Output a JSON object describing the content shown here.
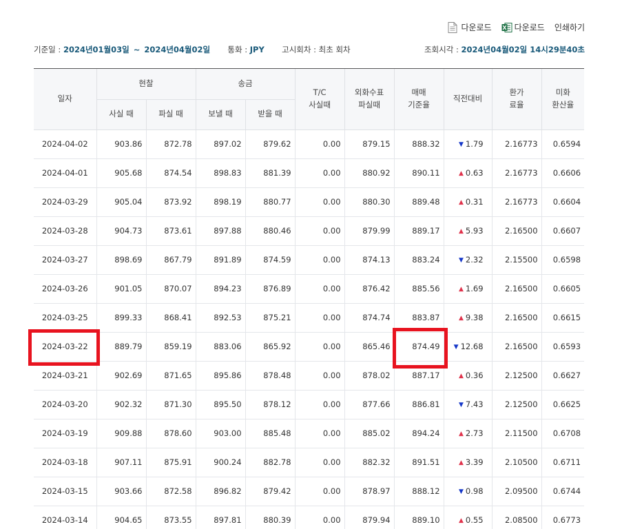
{
  "toolbar": {
    "pdf_download": "다운로드",
    "excel_download": "다운로드",
    "print": "인쇄하기"
  },
  "info": {
    "base_date_label": "기준일 :",
    "start_date": "2024년01월03일",
    "tilde": "~",
    "end_date": "2024년04월02일",
    "currency_label": "통화 :",
    "currency": "JPY",
    "notice_round_label": "고시회차 :",
    "notice_round": "최초 회차",
    "query_time_label": "조회시각 :",
    "query_time": "2024년04월02일 14시29분40초"
  },
  "headers": {
    "date": "일자",
    "cash": "현찰",
    "cash_buy": "사실 때",
    "cash_sell": "파실 때",
    "remit": "송금",
    "remit_send": "보낼 때",
    "remit_receive": "받을 때",
    "tc": "T/C\n사실때",
    "check": "외화수표\n파실때",
    "base_rate": "매매\n기준율",
    "change": "직전대비",
    "commission": "환가\n료율",
    "usd_rate": "미화\n환산율"
  },
  "colors": {
    "up_arrow": "#e0334c",
    "down_arrow": "#1537c8",
    "highlight": "#e8131f",
    "accent_text": "#1a5a7a"
  },
  "rows": [
    {
      "date": "2024-04-02",
      "cash_buy": "903.86",
      "cash_sell": "872.78",
      "send": "897.02",
      "receive": "879.62",
      "tc": "0.00",
      "check": "879.15",
      "base": "888.32",
      "dir": "down",
      "change": "1.79",
      "commission": "2.16773",
      "usd": "0.6594"
    },
    {
      "date": "2024-04-01",
      "cash_buy": "905.68",
      "cash_sell": "874.54",
      "send": "898.83",
      "receive": "881.39",
      "tc": "0.00",
      "check": "880.92",
      "base": "890.11",
      "dir": "up",
      "change": "0.63",
      "commission": "2.16773",
      "usd": "0.6606"
    },
    {
      "date": "2024-03-29",
      "cash_buy": "905.04",
      "cash_sell": "873.92",
      "send": "898.19",
      "receive": "880.77",
      "tc": "0.00",
      "check": "880.30",
      "base": "889.48",
      "dir": "up",
      "change": "0.31",
      "commission": "2.16773",
      "usd": "0.6604"
    },
    {
      "date": "2024-03-28",
      "cash_buy": "904.73",
      "cash_sell": "873.61",
      "send": "897.88",
      "receive": "880.46",
      "tc": "0.00",
      "check": "879.99",
      "base": "889.17",
      "dir": "up",
      "change": "5.93",
      "commission": "2.16500",
      "usd": "0.6607"
    },
    {
      "date": "2024-03-27",
      "cash_buy": "898.69",
      "cash_sell": "867.79",
      "send": "891.89",
      "receive": "874.59",
      "tc": "0.00",
      "check": "874.13",
      "base": "883.24",
      "dir": "down",
      "change": "2.32",
      "commission": "2.15500",
      "usd": "0.6598"
    },
    {
      "date": "2024-03-26",
      "cash_buy": "901.05",
      "cash_sell": "870.07",
      "send": "894.23",
      "receive": "876.89",
      "tc": "0.00",
      "check": "876.42",
      "base": "885.56",
      "dir": "up",
      "change": "1.69",
      "commission": "2.16500",
      "usd": "0.6605"
    },
    {
      "date": "2024-03-25",
      "cash_buy": "899.33",
      "cash_sell": "868.41",
      "send": "892.53",
      "receive": "875.21",
      "tc": "0.00",
      "check": "874.74",
      "base": "883.87",
      "dir": "up",
      "change": "9.38",
      "commission": "2.16500",
      "usd": "0.6615"
    },
    {
      "date": "2024-03-22",
      "cash_buy": "889.79",
      "cash_sell": "859.19",
      "send": "883.06",
      "receive": "865.92",
      "tc": "0.00",
      "check": "865.46",
      "base": "874.49",
      "dir": "down",
      "change": "12.68",
      "commission": "2.16500",
      "usd": "0.6593"
    },
    {
      "date": "2024-03-21",
      "cash_buy": "902.69",
      "cash_sell": "871.65",
      "send": "895.86",
      "receive": "878.48",
      "tc": "0.00",
      "check": "878.02",
      "base": "887.17",
      "dir": "up",
      "change": "0.36",
      "commission": "2.12500",
      "usd": "0.6627"
    },
    {
      "date": "2024-03-20",
      "cash_buy": "902.32",
      "cash_sell": "871.30",
      "send": "895.50",
      "receive": "878.12",
      "tc": "0.00",
      "check": "877.66",
      "base": "886.81",
      "dir": "down",
      "change": "7.43",
      "commission": "2.12500",
      "usd": "0.6625"
    },
    {
      "date": "2024-03-19",
      "cash_buy": "909.88",
      "cash_sell": "878.60",
      "send": "903.00",
      "receive": "885.48",
      "tc": "0.00",
      "check": "885.02",
      "base": "894.24",
      "dir": "up",
      "change": "2.73",
      "commission": "2.11500",
      "usd": "0.6708"
    },
    {
      "date": "2024-03-18",
      "cash_buy": "907.11",
      "cash_sell": "875.91",
      "send": "900.24",
      "receive": "882.78",
      "tc": "0.00",
      "check": "882.32",
      "base": "891.51",
      "dir": "up",
      "change": "3.39",
      "commission": "2.10500",
      "usd": "0.6711"
    },
    {
      "date": "2024-03-15",
      "cash_buy": "903.66",
      "cash_sell": "872.58",
      "send": "896.82",
      "receive": "879.42",
      "tc": "0.00",
      "check": "878.97",
      "base": "888.12",
      "dir": "down",
      "change": "0.98",
      "commission": "2.09500",
      "usd": "0.6744"
    },
    {
      "date": "2024-03-14",
      "cash_buy": "904.65",
      "cash_sell": "873.55",
      "send": "897.81",
      "receive": "880.39",
      "tc": "0.00",
      "check": "879.94",
      "base": "889.10",
      "dir": "up",
      "change": "0.55",
      "commission": "2.08500",
      "usd": "0.6773"
    }
  ]
}
